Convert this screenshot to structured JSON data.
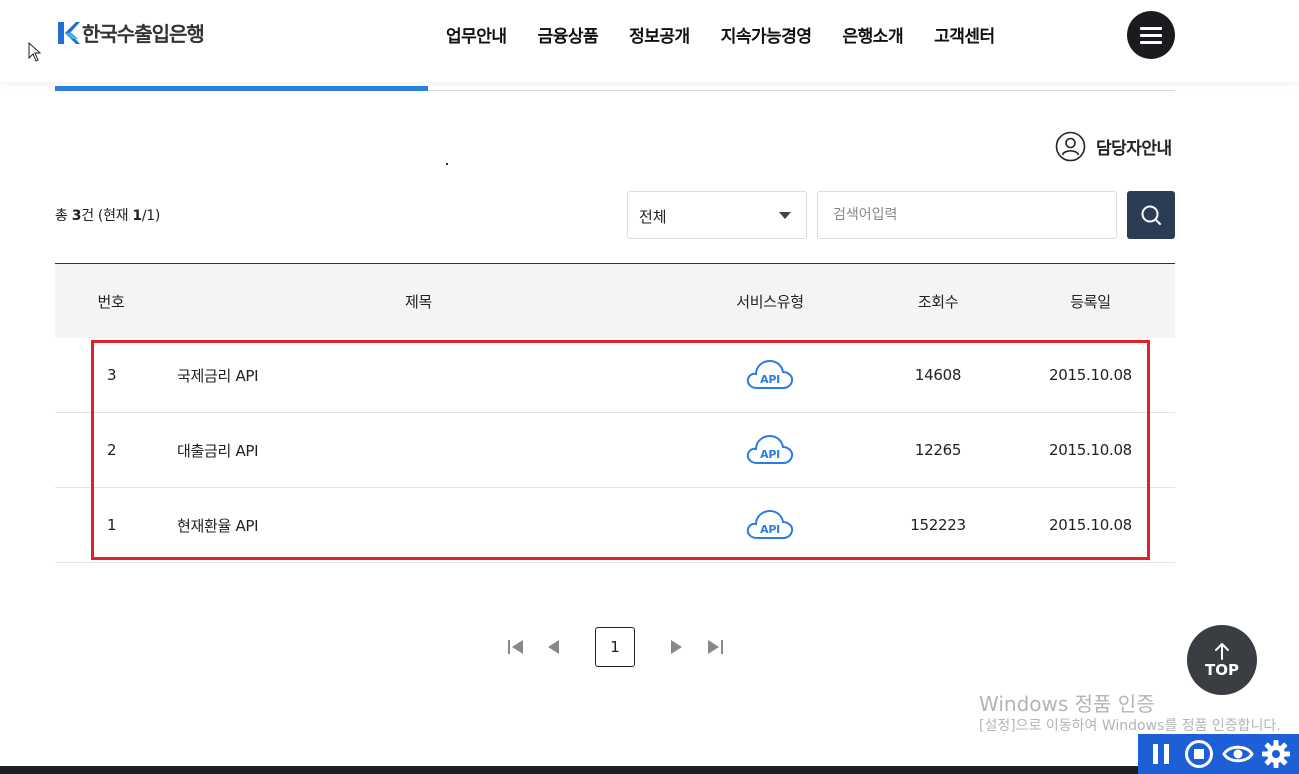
{
  "header": {
    "logo_text": "한국수출입은행",
    "nav": [
      "업무안내",
      "금융상품",
      "정보공개",
      "지속가능경영",
      "은행소개",
      "고객센터"
    ]
  },
  "contact": {
    "label": "담당자안내"
  },
  "search": {
    "total_prefix": "총 ",
    "total_count": "3",
    "total_mid": "건 (현재 ",
    "current_page": "1",
    "total_pages": "/1",
    "total_suffix": ")",
    "filter_value": "전체",
    "placeholder": "검색어입력"
  },
  "table": {
    "headers": {
      "no": "번호",
      "title": "제목",
      "type": "서비스유형",
      "views": "조회수",
      "date": "등록일"
    },
    "rows": [
      {
        "no": "3",
        "title": "국제금리 API",
        "type_icon": "API",
        "views": "14608",
        "date": "2015.10.08"
      },
      {
        "no": "2",
        "title": "대출금리 API",
        "type_icon": "API",
        "views": "12265",
        "date": "2015.10.08"
      },
      {
        "no": "1",
        "title": "현재환율 API",
        "type_icon": "API",
        "views": "152223",
        "date": "2015.10.08"
      }
    ]
  },
  "pagination": {
    "current": "1"
  },
  "top_button": {
    "label": "TOP"
  },
  "watermark": {
    "line1": "Windows 정품 인증",
    "line2": "[설정]으로 이동하여 Windows를 정품 인증합니다."
  },
  "colors": {
    "accent": "#2a7de1",
    "search_button": "#2b3d55",
    "highlight": "#e0202a",
    "overlay_toolbar": "#1c5fd6"
  },
  "icons": [
    "menu-icon",
    "user-circle-icon",
    "search-icon",
    "cloud-api-icon",
    "first-page-icon",
    "prev-page-icon",
    "next-page-icon",
    "last-page-icon",
    "arrow-up-icon",
    "pause-icon",
    "stop-icon",
    "eye-icon",
    "gear-icon"
  ]
}
